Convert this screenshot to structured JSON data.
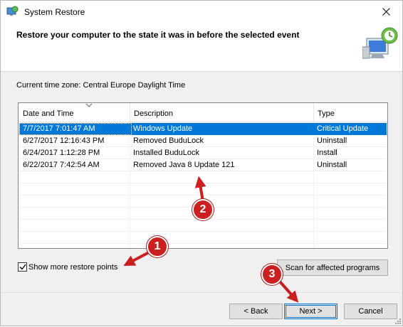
{
  "window": {
    "title": "System Restore",
    "heading": "Restore your computer to the state it was in before the selected event",
    "icons": {
      "app": "system-restore-icon",
      "header": "restore-computer-icon",
      "close": "close-icon"
    }
  },
  "timezone_text": "Current time zone: Central Europe Daylight Time",
  "list": {
    "columns": [
      "Date and Time",
      "Description",
      "Type"
    ],
    "sort_indicator": "sort-down-arrow-icon",
    "rows": [
      {
        "date": "7/7/2017 7:01:47 AM",
        "description": "Windows Update",
        "type": "Critical Update",
        "selected": true
      },
      {
        "date": "6/27/2017 12:16:43 PM",
        "description": "Removed BuduLock",
        "type": "Uninstall",
        "selected": false
      },
      {
        "date": "6/24/2017 1:12:28 PM",
        "description": "Installed BuduLock",
        "type": "Install",
        "selected": false
      },
      {
        "date": "6/22/2017 7:42:54 AM",
        "description": "Removed Java 8 Update 121",
        "type": "Uninstall",
        "selected": false
      }
    ]
  },
  "show_more": {
    "label": "Show more restore points",
    "checked": true
  },
  "buttons": {
    "scan": "Scan for affected programs",
    "back": "< Back",
    "next": "Next >",
    "cancel": "Cancel"
  },
  "annotations": {
    "badges": [
      "1",
      "2",
      "3"
    ],
    "color": "#cc1f1f"
  },
  "colors": {
    "selection": "#0078d7",
    "window_bg": "#f0f0f0"
  }
}
